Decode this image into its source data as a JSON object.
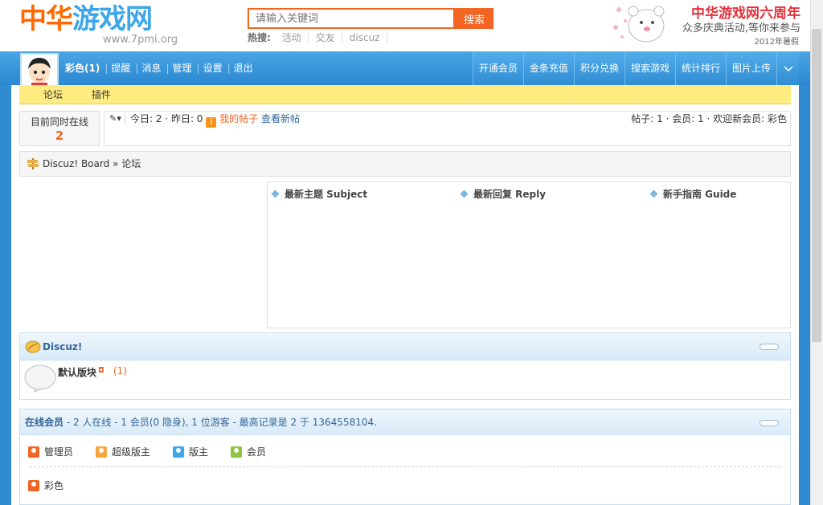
{
  "logo": {
    "part1": "中华",
    "part2": "游戏网",
    "domain": "www.7pmi.org"
  },
  "search": {
    "placeholder": "请输入关键词",
    "button": "搜索",
    "hot_label": "热搜:",
    "hot_items": [
      "活动",
      "交友",
      "discuz"
    ]
  },
  "promo": {
    "title": "中华游戏网六周年",
    "subtitle": "众多庆典活动,等你来参与",
    "small": "2012年暑假"
  },
  "user_nav": {
    "name": "彩色",
    "count": "(1)",
    "items": [
      "提醒",
      "消息",
      "管理",
      "设置",
      "退出"
    ]
  },
  "main_nav": [
    "开通会员",
    "金条充值",
    "积分兑换",
    "搜索游戏",
    "统计排行",
    "图片上传"
  ],
  "sub_nav": [
    "论坛",
    "插件"
  ],
  "online": {
    "label": "目前同时在线",
    "value": "2"
  },
  "stats": {
    "today": "今日: 2",
    "yesterday": "昨日: 0",
    "my_posts": "我的帖子",
    "new_posts": "查看新帖",
    "right": "帖子: 1 · 会员: 1 · 欢迎新会员: 彩色"
  },
  "breadcrumb": {
    "root": "Discuz! Board",
    "sep": "»",
    "current": "论坛"
  },
  "news_cols": [
    "最新主题 Subject",
    "最新回复 Reply",
    "新手指南 Guide"
  ],
  "forum": {
    "category": "Discuz!",
    "name": "默认版块",
    "count": "(1)"
  },
  "members": {
    "title_bold": "在线会员",
    "title_rest": " - 2 人在线 - 1 会员(0 隐身), 1 位游客 - 最高记录是 2 于 1364558104.",
    "legend": [
      {
        "label": "管理员",
        "color": "#f26522"
      },
      {
        "label": "超级版主",
        "color": "#f7a63d"
      },
      {
        "label": "版主",
        "color": "#3ca7e8"
      },
      {
        "label": "会员",
        "color": "#8dc63f"
      }
    ],
    "online_user": "彩色"
  }
}
